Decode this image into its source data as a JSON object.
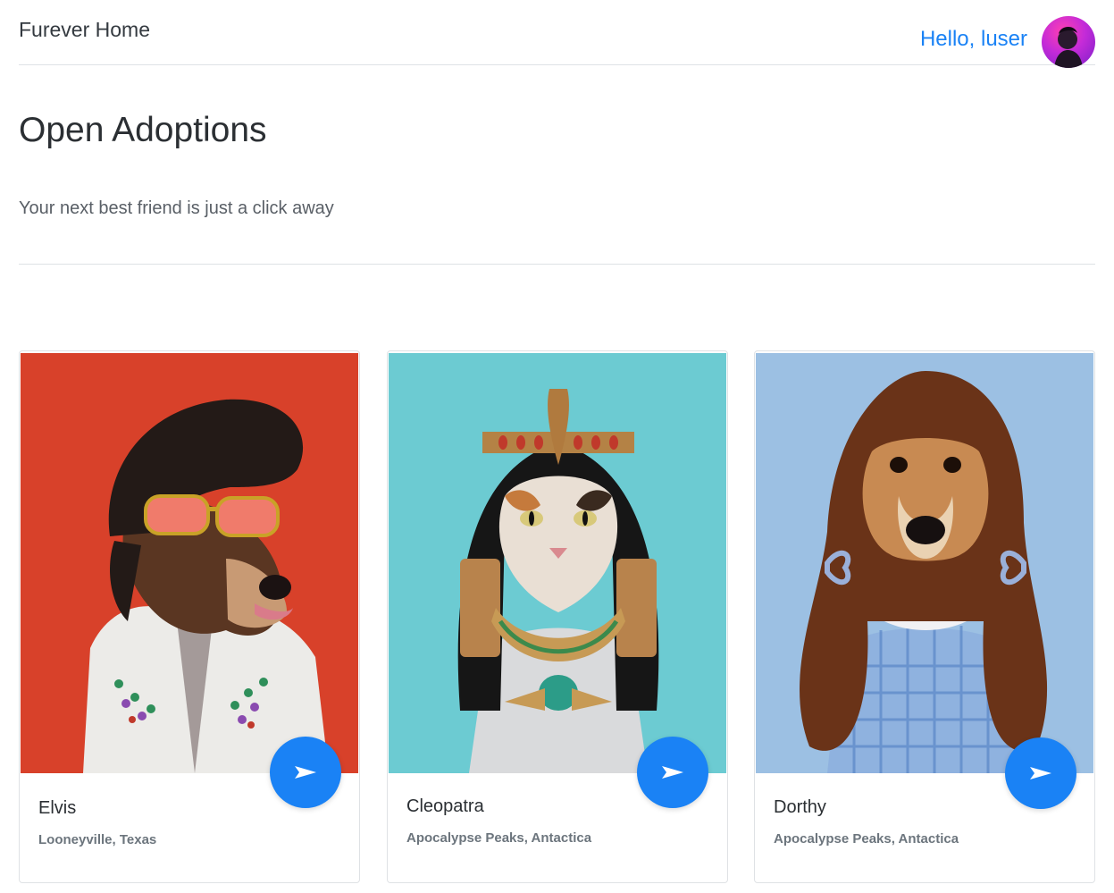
{
  "navbar": {
    "brand": "Furever Home",
    "greeting": "Hello, luser"
  },
  "header": {
    "title": "Open Adoptions",
    "subtitle": "Your next best friend is just a click away"
  },
  "pets": [
    {
      "name": "Elvis",
      "location": "Looneyville, Texas",
      "bg_color": "#d8412a"
    },
    {
      "name": "Cleopatra",
      "location": "Apocalypse Peaks, Antactica",
      "bg_color": "#6ccbd2"
    },
    {
      "name": "Dorthy",
      "location": "Apocalypse Peaks, Antactica",
      "bg_color": "#9cc0e3"
    }
  ],
  "colors": {
    "accent": "#1a82f5",
    "muted_text": "#6c757d"
  },
  "icons": {
    "action_button": "play-arrow-icon"
  }
}
